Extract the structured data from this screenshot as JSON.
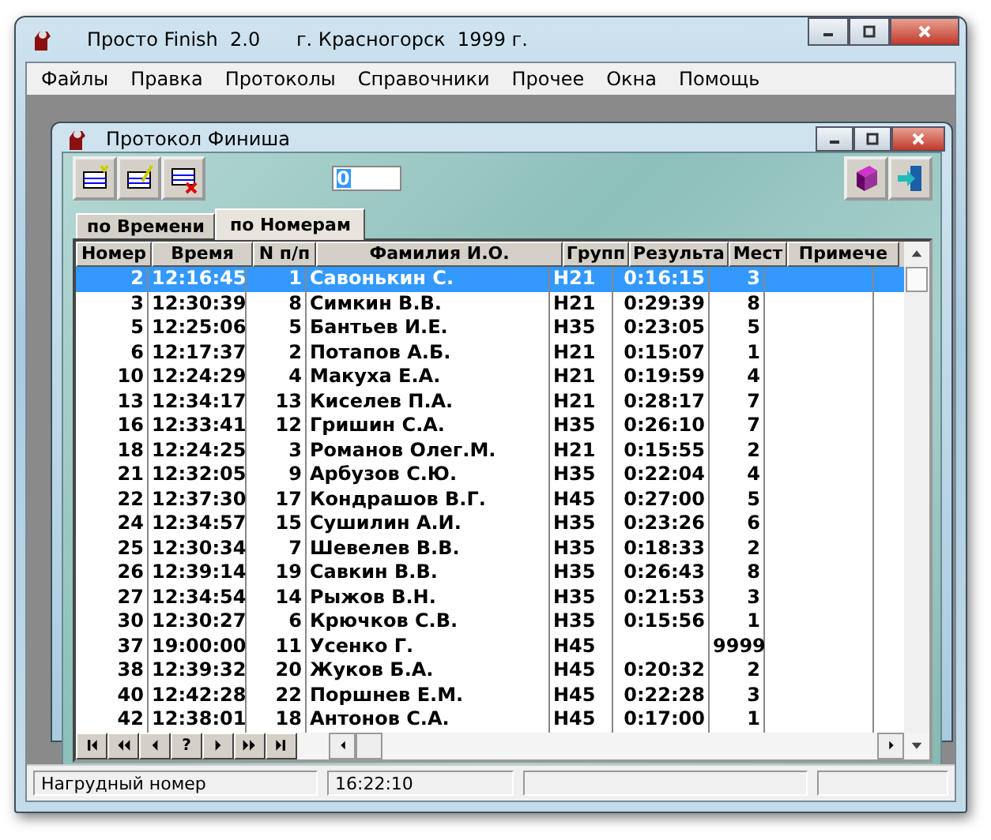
{
  "window": {
    "title": "Просто Finish  2.0      г. Красногорск  1999 г."
  },
  "menu": [
    "Файлы",
    "Правка",
    "Протоколы",
    "Справочники",
    "Прочее",
    "Окна",
    "Помощь"
  ],
  "child": {
    "title": "Протокол Финиша",
    "number_field": {
      "value": "0"
    },
    "tabs": [
      {
        "label": "по Времени",
        "selected": false
      },
      {
        "label": "по Номерам",
        "selected": true
      }
    ],
    "table": {
      "columns": [
        "Номер",
        "Время",
        "N п/п",
        "Фамилия И.О.",
        "Групп",
        "Результа",
        "Мест",
        "Примече"
      ],
      "rows": [
        {
          "number": "2",
          "time": "12:16:45",
          "order": "1",
          "name": "Савонькин С.",
          "group": "H21",
          "result": "0:16:15",
          "place": "3",
          "selected": true
        },
        {
          "number": "3",
          "time": "12:30:39",
          "order": "8",
          "name": "Симкин В.В.",
          "group": "H21",
          "result": "0:29:39",
          "place": "8",
          "selected": false
        },
        {
          "number": "5",
          "time": "12:25:06",
          "order": "5",
          "name": "Бантьев И.Е.",
          "group": "H35",
          "result": "0:23:05",
          "place": "5",
          "selected": false
        },
        {
          "number": "6",
          "time": "12:17:37",
          "order": "2",
          "name": "Потапов А.Б.",
          "group": "H21",
          "result": "0:15:07",
          "place": "1",
          "selected": false
        },
        {
          "number": "10",
          "time": "12:24:29",
          "order": "4",
          "name": "Макуха Е.А.",
          "group": "H21",
          "result": "0:19:59",
          "place": "4",
          "selected": false
        },
        {
          "number": "13",
          "time": "12:34:17",
          "order": "13",
          "name": "Киселев П.А.",
          "group": "H21",
          "result": "0:28:17",
          "place": "7",
          "selected": false
        },
        {
          "number": "16",
          "time": "12:33:41",
          "order": "12",
          "name": "Гришин С.А.",
          "group": "H35",
          "result": "0:26:10",
          "place": "7",
          "selected": false
        },
        {
          "number": "18",
          "time": "12:24:25",
          "order": "3",
          "name": "Романов Олег.М.",
          "group": "H21",
          "result": "0:15:55",
          "place": "2",
          "selected": false
        },
        {
          "number": "21",
          "time": "12:32:05",
          "order": "9",
          "name": "Арбузов С.Ю.",
          "group": "H35",
          "result": "0:22:04",
          "place": "4",
          "selected": false
        },
        {
          "number": "22",
          "time": "12:37:30",
          "order": "17",
          "name": "Кондрашов В.Г.",
          "group": "H45",
          "result": "0:27:00",
          "place": "5",
          "selected": false
        },
        {
          "number": "24",
          "time": "12:34:57",
          "order": "15",
          "name": "Сушилин А.И.",
          "group": "H35",
          "result": "0:23:26",
          "place": "6",
          "selected": false
        },
        {
          "number": "25",
          "time": "12:30:34",
          "order": "7",
          "name": "Шевелев В.В.",
          "group": "H35",
          "result": "0:18:33",
          "place": "2",
          "selected": false
        },
        {
          "number": "26",
          "time": "12:39:14",
          "order": "19",
          "name": "Савкин В.В.",
          "group": "H35",
          "result": "0:26:43",
          "place": "8",
          "selected": false
        },
        {
          "number": "27",
          "time": "12:34:54",
          "order": "14",
          "name": "Рыжов В.Н.",
          "group": "H35",
          "result": "0:21:53",
          "place": "3",
          "selected": false
        },
        {
          "number": "30",
          "time": "12:30:27",
          "order": "6",
          "name": "Крючков С.В.",
          "group": "H35",
          "result": "0:15:56",
          "place": "1",
          "selected": false
        },
        {
          "number": "37",
          "time": "19:00:00",
          "order": "11",
          "name": "Усенко Г.",
          "group": "H45",
          "place": "9999",
          "selected": false
        },
        {
          "number": "38",
          "time": "12:39:32",
          "order": "20",
          "name": "Жуков Б.А.",
          "group": "H45",
          "result": "0:20:32",
          "place": "2",
          "selected": false
        },
        {
          "number": "40",
          "time": "12:42:28",
          "order": "22",
          "name": "Поршнев Е.М.",
          "group": "H45",
          "result": "0:22:28",
          "place": "3",
          "selected": false
        },
        {
          "number": "42",
          "time": "12:38:01",
          "order": "18",
          "name": "Антонов С.А.",
          "group": "H45",
          "result": "0:17:00",
          "place": "1",
          "selected": false
        }
      ]
    },
    "navigator": [
      {
        "kind": "first"
      },
      {
        "kind": "prev_page"
      },
      {
        "kind": "prev"
      },
      {
        "kind": "help",
        "label": "?"
      },
      {
        "kind": "next"
      },
      {
        "kind": "next_page"
      },
      {
        "kind": "last"
      }
    ]
  },
  "status_bar": [
    {
      "text": "Нагрудный номер"
    },
    {
      "text": "16:22:10"
    }
  ]
}
